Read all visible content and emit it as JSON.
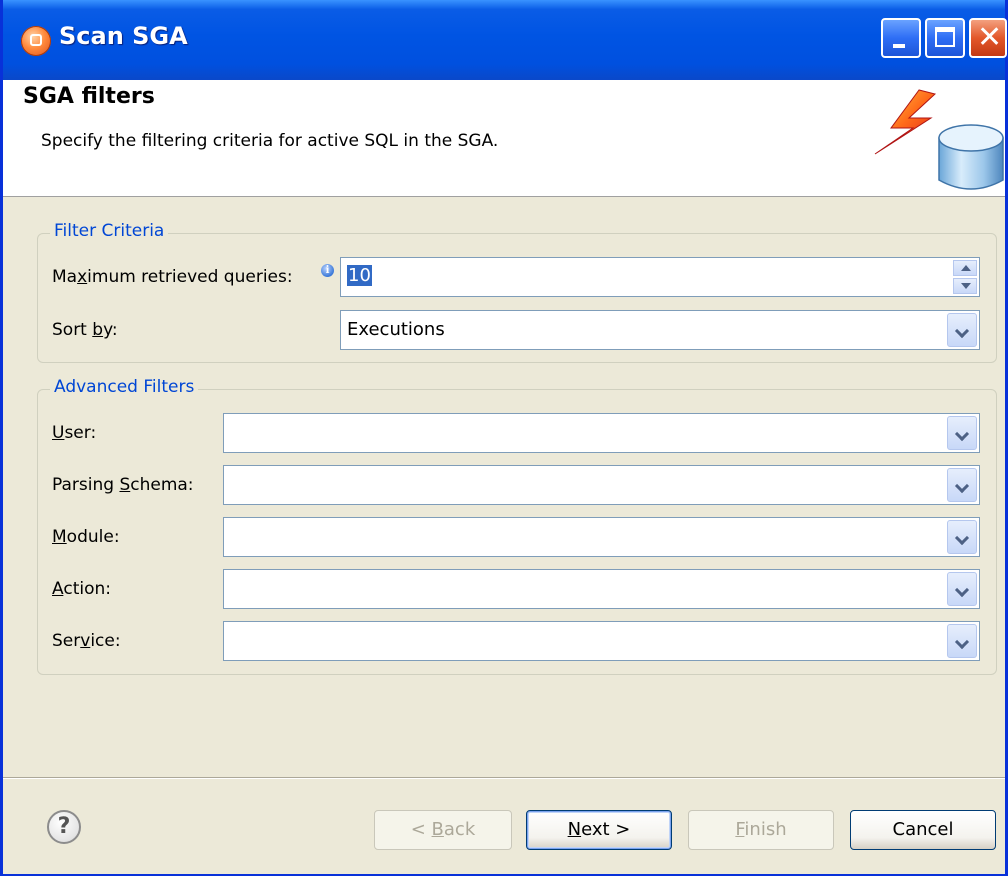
{
  "window": {
    "title": "Scan SGA",
    "close_glyph": "✕"
  },
  "header": {
    "title": "SGA filters",
    "description": "Specify the filtering criteria for active SQL in the SGA."
  },
  "filter_criteria": {
    "group_title": "Filter Criteria",
    "max_queries": {
      "label_pre": "Ma",
      "label_mnemonic": "x",
      "label_post": "imum retrieved queries:",
      "value": "10",
      "info_glyph": "i"
    },
    "sort_by": {
      "label_pre": "Sort ",
      "label_mnemonic": "b",
      "label_post": "y:",
      "value": "Executions"
    }
  },
  "advanced_filters": {
    "group_title": "Advanced Filters",
    "user": {
      "label_pre": "",
      "label_mnemonic": "U",
      "label_post": "ser:",
      "value": ""
    },
    "parsing_schema": {
      "label_pre": "Parsing ",
      "label_mnemonic": "S",
      "label_post": "chema:",
      "value": ""
    },
    "module": {
      "label_pre": "",
      "label_mnemonic": "M",
      "label_post": "odule:",
      "value": ""
    },
    "action": {
      "label_pre": "",
      "label_mnemonic": "A",
      "label_post": "ction:",
      "value": ""
    },
    "service": {
      "label_pre": "Ser",
      "label_mnemonic": "v",
      "label_post": "ice:",
      "value": ""
    }
  },
  "footer": {
    "help_glyph": "?",
    "back": {
      "label_pre": "< ",
      "label_mnemonic": "B",
      "label_post": "ack"
    },
    "next": {
      "label_pre": "",
      "label_mnemonic": "N",
      "label_post": "ext >"
    },
    "finish": {
      "label_pre": "",
      "label_mnemonic": "F",
      "label_post": "inish"
    },
    "cancel": {
      "label": "Cancel"
    }
  }
}
